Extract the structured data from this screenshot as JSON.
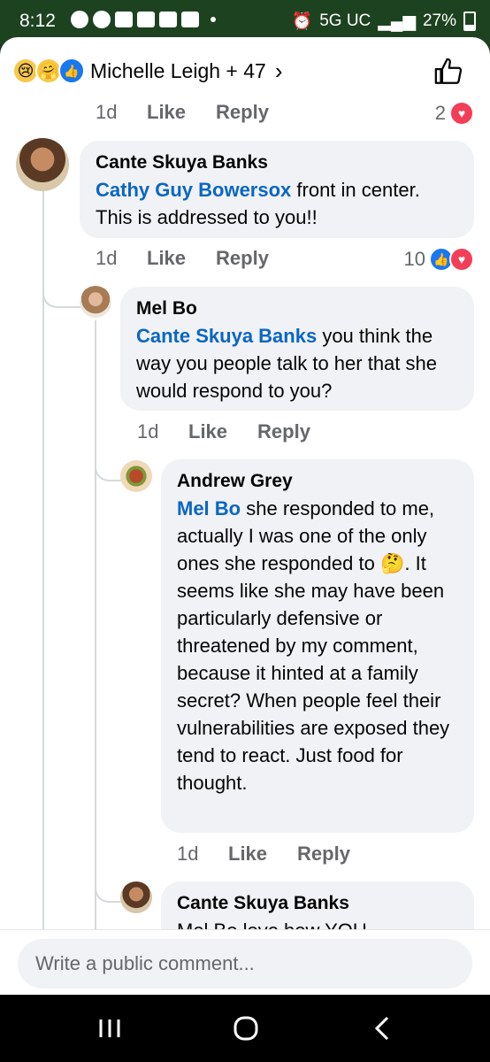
{
  "status_bar": {
    "time": "8:12",
    "network": "5G UC",
    "battery": "27%"
  },
  "reactions_header": {
    "names": "Michelle Leigh + 47"
  },
  "comments": [
    {
      "age": "1d",
      "like": "Like",
      "reply": "Reply",
      "count": "2"
    },
    {
      "author": "Cante Skuya Banks",
      "mention": "Cathy Guy Bowersox",
      "text": " front in center. This is addressed to you!!",
      "age": "1d",
      "like": "Like",
      "reply": "Reply",
      "count": "10"
    },
    {
      "author": "Mel Bo",
      "mention": "Cante Skuya Banks",
      "text": " you think the way you people talk to her that she would respond to you?",
      "age": "1d",
      "like": "Like",
      "reply": "Reply"
    },
    {
      "author": "Andrew Grey",
      "mention": "Mel Bo",
      "text_before": " she responded to me, actually I was one of the only ones she responded to ",
      "emoji": "🤔",
      "text_after": ". It seems like she may have been particularly defensive or threatened by my comment, because it hinted at a family secret? When people feel their vulnerabilities are exposed they tend to react. Just food for thought.",
      "age": "1d",
      "like": "Like",
      "reply": "Reply"
    },
    {
      "author": "Cante Skuya Banks",
      "partial": "Mel Bo love how YOU"
    }
  ],
  "composer": {
    "placeholder": "Write a public comment..."
  }
}
